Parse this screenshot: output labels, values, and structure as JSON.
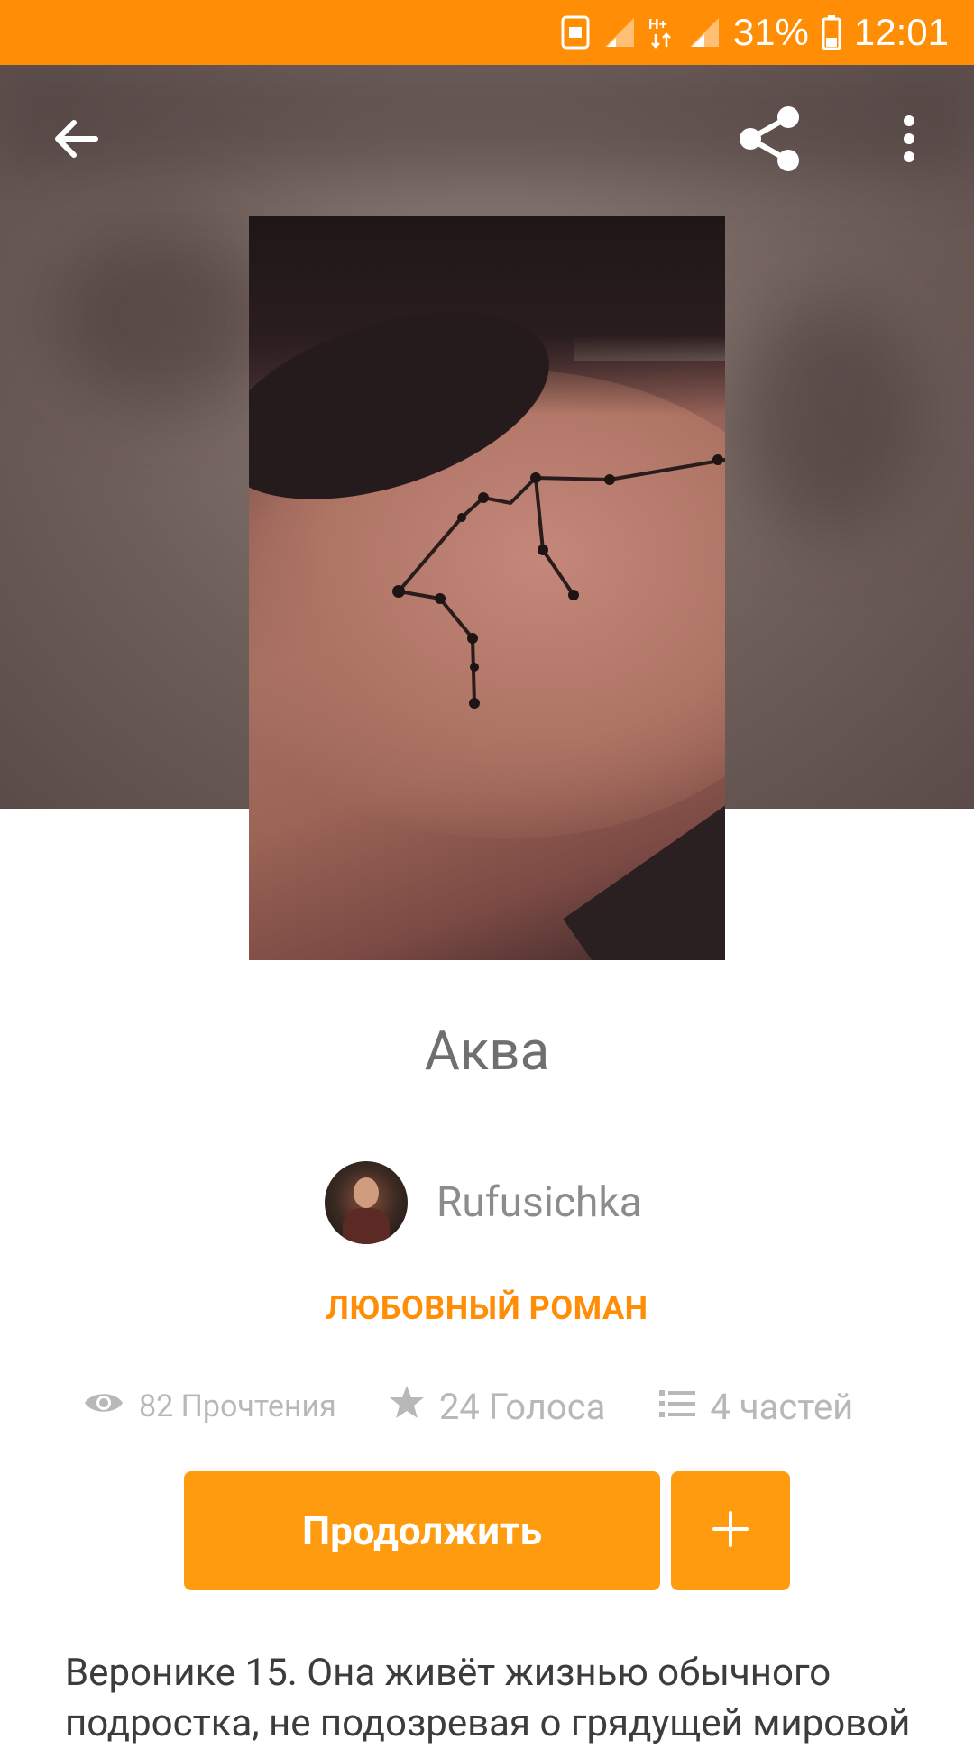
{
  "status_bar": {
    "battery": "31%",
    "time": "12:01",
    "icons": [
      "nfc-icon",
      "signal-icon",
      "network-h-plus-icon",
      "signal-icon",
      "battery-icon"
    ]
  },
  "toolbar": {
    "back_icon": "arrow-left-icon",
    "share_icon": "share-icon",
    "more_icon": "more-vert-icon"
  },
  "story": {
    "title": "Аква",
    "author": "Rufusichka",
    "genre": "ЛЮБОВНЫЙ РОМАН",
    "stats": {
      "reads": "82 Прочтения",
      "votes": "24 Голоса",
      "parts": "4 частей"
    },
    "description": "Веронике 15. Она живёт жизнью обычного подростка, не подозревая о грядущей мировой"
  },
  "actions": {
    "continue_label": "Продолжить",
    "add_icon": "plus-icon"
  },
  "colors": {
    "accent": "#ff8d05",
    "button": "#ff9b0f",
    "hero_bg": "#6f5f5b"
  }
}
